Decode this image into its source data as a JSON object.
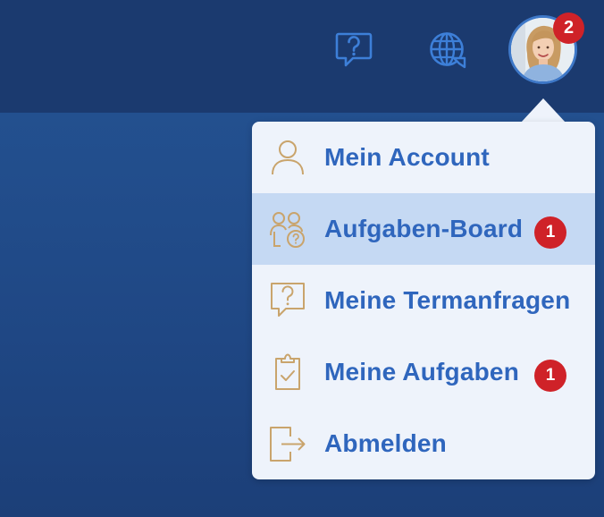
{
  "header": {
    "icons": {
      "help": "help-chat-icon",
      "language": "globe-chat-icon"
    },
    "avatar_badge": "2"
  },
  "user_menu": {
    "items": [
      {
        "label": "Mein Account",
        "icon": "user-icon",
        "badge": null,
        "active": false
      },
      {
        "label": "Aufgaben-Board",
        "icon": "users-question-icon",
        "badge": "1",
        "active": true
      },
      {
        "label": "Meine Termanfragen",
        "icon": "chat-question-icon",
        "badge": null,
        "active": false
      },
      {
        "label": "Meine Aufgaben",
        "icon": "clipboard-check-icon",
        "badge": "1",
        "active": false
      },
      {
        "label": "Abmelden",
        "icon": "logout-icon",
        "badge": null,
        "active": false
      }
    ]
  },
  "colors": {
    "header_bg": "#1b3a6f",
    "menu_bg": "#eef3fb",
    "active_item_bg": "#c5d9f3",
    "label_blue": "#2f66bd",
    "icon_gold": "#c9a46c",
    "badge_red": "#cf2228"
  }
}
